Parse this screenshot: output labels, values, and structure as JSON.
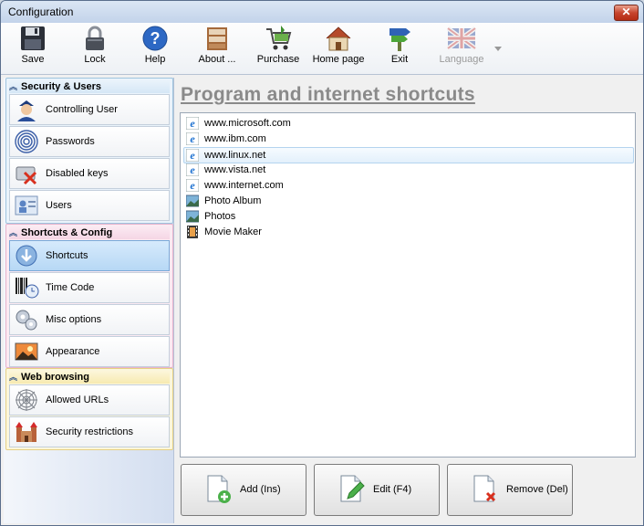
{
  "window": {
    "title": "Configuration",
    "close_glyph": "✕"
  },
  "toolbar": {
    "items": [
      {
        "label": "Save",
        "icon": "floppy-disk-icon"
      },
      {
        "label": "Lock",
        "icon": "padlock-icon"
      },
      {
        "label": "Help",
        "icon": "help-icon"
      },
      {
        "label": "About ...",
        "icon": "info-box-icon"
      },
      {
        "label": "Purchase",
        "icon": "shopping-cart-icon"
      },
      {
        "label": "Home page",
        "icon": "house-icon"
      },
      {
        "label": "Exit",
        "icon": "exit-signpost-icon"
      },
      {
        "label": "Language",
        "icon": "uk-flag-icon",
        "disabled": true
      }
    ]
  },
  "sidebar": {
    "groups": [
      {
        "title": "Security & Users",
        "items": [
          {
            "label": "Controlling User",
            "icon": "police-officer-icon"
          },
          {
            "label": "Passwords",
            "icon": "fingerprint-icon"
          },
          {
            "label": "Disabled keys",
            "icon": "disabled-keys-icon"
          },
          {
            "label": "Users",
            "icon": "users-icon"
          }
        ]
      },
      {
        "title": "Shortcuts & Config",
        "items": [
          {
            "label": "Shortcuts",
            "icon": "shortcut-arrow-icon",
            "selected": true
          },
          {
            "label": "Time Code",
            "icon": "barcode-clock-icon"
          },
          {
            "label": "Misc options",
            "icon": "gears-icon"
          },
          {
            "label": "Appearance",
            "icon": "landscape-picture-icon"
          }
        ]
      },
      {
        "title": "Web browsing",
        "items": [
          {
            "label": "Allowed URLs",
            "icon": "spider-web-icon"
          },
          {
            "label": "Security restrictions",
            "icon": "castle-icon"
          }
        ]
      }
    ]
  },
  "main": {
    "heading": "Program and internet shortcuts",
    "shortcuts": [
      {
        "label": "www.microsoft.com",
        "icon": "ie-icon"
      },
      {
        "label": "www.ibm.com",
        "icon": "ie-icon"
      },
      {
        "label": "www.linux.net",
        "icon": "ie-icon",
        "selected": true
      },
      {
        "label": "www.vista.net",
        "icon": "ie-icon"
      },
      {
        "label": "www.internet.com",
        "icon": "ie-icon"
      },
      {
        "label": "Photo Album",
        "icon": "photo-icon"
      },
      {
        "label": "Photos",
        "icon": "photo-icon"
      },
      {
        "label": "Movie Maker",
        "icon": "film-icon"
      }
    ],
    "buttons": {
      "add": "Add (Ins)",
      "edit": "Edit (F4)",
      "remove": "Remove (Del)"
    }
  },
  "colors": {
    "selection": "#b7d8f5",
    "heading": "#8a8a8a"
  }
}
